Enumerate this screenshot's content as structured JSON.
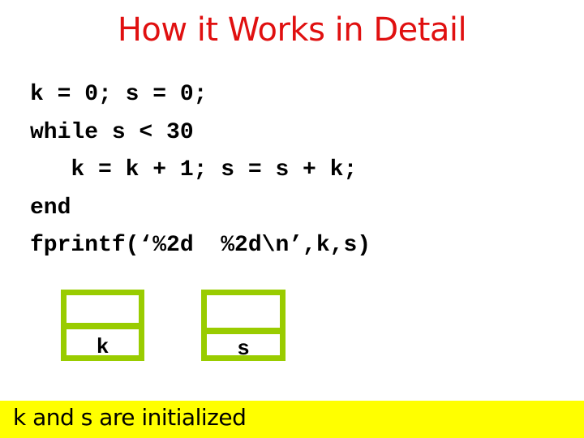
{
  "title": "How it Works in Detail",
  "code_lines": [
    "k = 0; s = 0;",
    "while s < 30",
    "   k = k + 1; s = s + k;",
    "end",
    "fprintf(‘%2d  %2d\\n’,k,s)"
  ],
  "variables": [
    {
      "name": "k",
      "value": ""
    },
    {
      "name": "s",
      "value": ""
    }
  ],
  "status": "k and s are initialized",
  "colors": {
    "title": "#e01010",
    "box_border": "#99cc00",
    "status_bg": "#ffff00"
  }
}
